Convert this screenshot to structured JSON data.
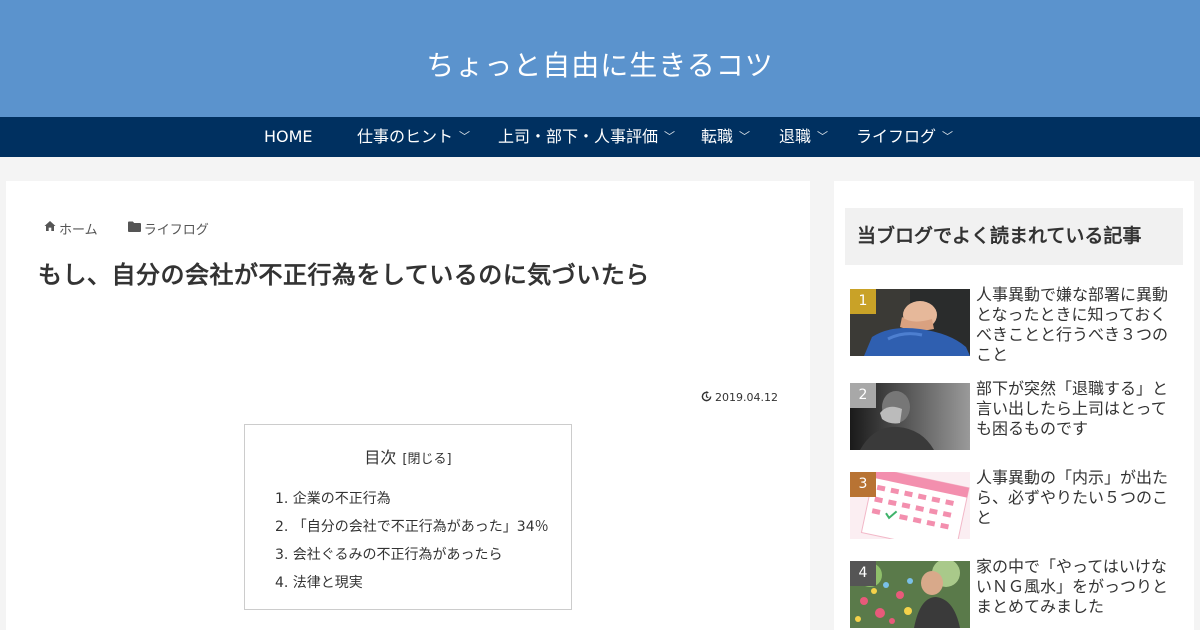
{
  "site": {
    "title": "ちょっと自由に生きるコツ"
  },
  "nav": {
    "items": [
      {
        "label": "HOME"
      },
      {
        "label": "仕事のヒント"
      },
      {
        "label": "上司・部下・人事評価"
      },
      {
        "label": "転職"
      },
      {
        "label": "退職"
      },
      {
        "label": "ライフログ"
      }
    ],
    "chevron_icon": "chevron-down-icon"
  },
  "breadcrumb": {
    "home": "ホーム",
    "category": "ライフログ",
    "home_icon": "home-icon",
    "category_icon": "folder-icon"
  },
  "post": {
    "title": "もし、自分の会社が不正行為をしているのに気づいたら",
    "updated_date": "2019.04.12",
    "date_icon": "update-icon"
  },
  "toc": {
    "heading": "目次",
    "toggle": "[閉じる]",
    "items": [
      "1. 企業の不正行為",
      "2. 「自分の会社で不正行為があった」34％",
      "3. 会社ぐるみの不正行為があったら",
      "4. 法律と現実"
    ]
  },
  "sidebar": {
    "widget_title": "当ブログでよく読まれている記事",
    "ranking": [
      {
        "rank": "1",
        "title": "人事異動で嫌な部署に異動となったときに知っておくべきことと行うべき３つのこと",
        "badge_color": "#c9a227"
      },
      {
        "rank": "2",
        "title": "部下が突然「退職する」と言い出したら上司はとっても困るものです",
        "badge_color": "#a8a8a8"
      },
      {
        "rank": "3",
        "title": "人事異動の「内示」が出たら、必ずやりたい５つのこと",
        "badge_color": "#b87333"
      },
      {
        "rank": "4",
        "title": "家の中で「やってはいけないＮＧ風水」をがっつりとまとめてみました",
        "badge_color": "#555555"
      }
    ]
  },
  "colors": {
    "header_bg": "#5b93cd",
    "nav_bg": "#003060",
    "page_bg": "#f4f4f4"
  }
}
